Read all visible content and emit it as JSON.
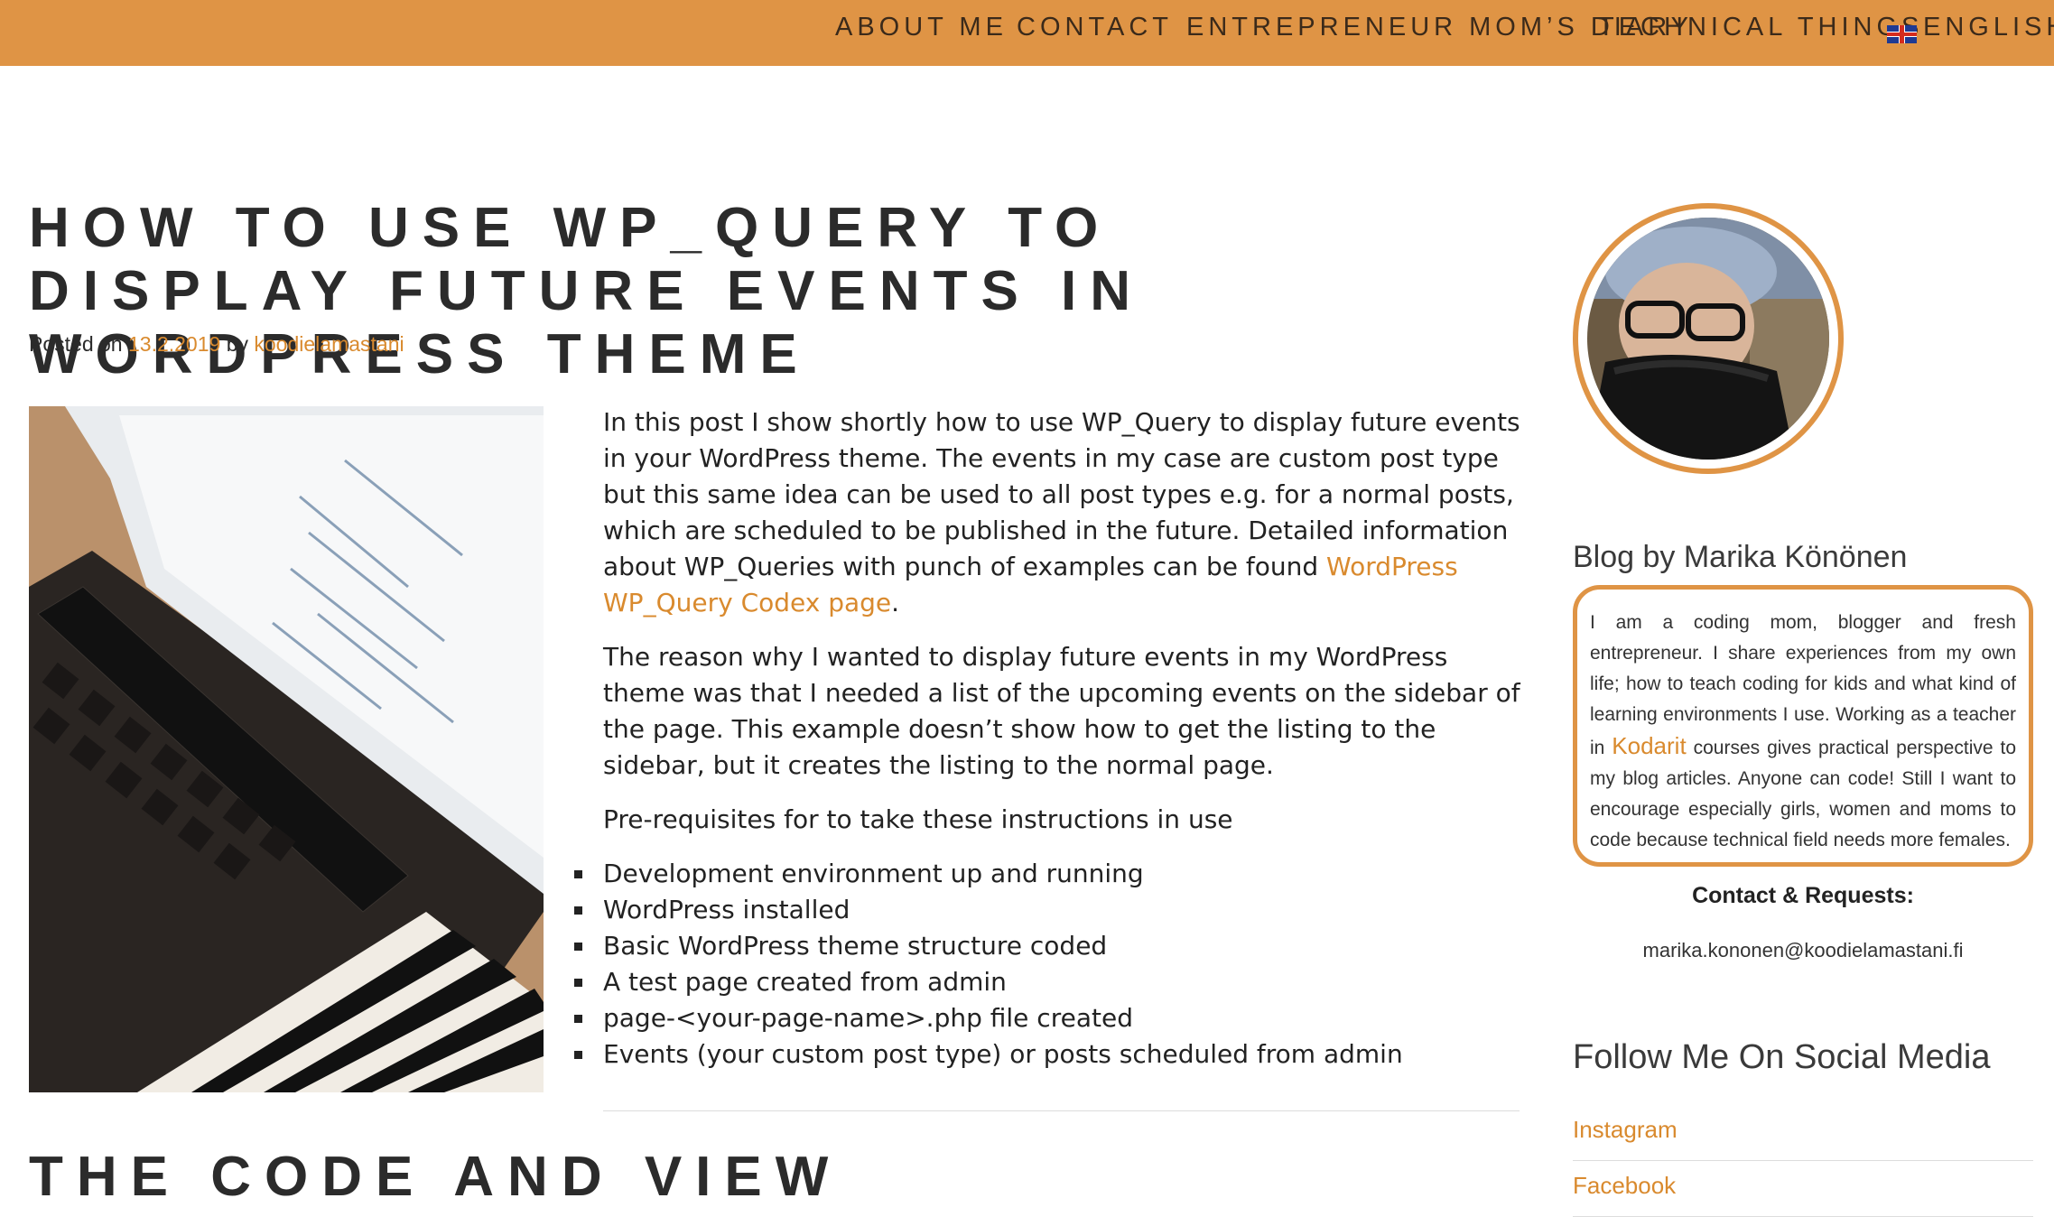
{
  "nav": {
    "items": [
      "ABOUT ME",
      "CONTACT",
      "ENTREPRENEUR MOM’S DIARY",
      "TECHNICAL THINGS"
    ],
    "language": "ENGLISH"
  },
  "post": {
    "title": "HOW TO USE WP_QUERY TO DISPLAY FUTURE EVENTS IN WORDPRESS THEME",
    "meta_prefix": "Posted on",
    "date": "13.2.2019",
    "by": "by",
    "author": "koodielamastani",
    "paragraph1_text": "In this post I show shortly how to use WP_Query to display future events in your WordPress theme. The events in my case are custom post type but this same idea can be used to all post types e.g. for a normal posts, which are scheduled to be published in the future. Detailed information about WP_Queries with punch of examples can be found ",
    "paragraph1_link": "WordPress WP_Query Codex page",
    "paragraph1_end": ".",
    "paragraph2": "The reason why I wanted to display future events in my WordPress theme was that I needed a list of the upcoming events on the sidebar of the page. This example doesn’t show how to get the listing to the sidebar, but it creates the listing to the normal page.",
    "paragraph3": "Pre-requisites for to take these instructions in use",
    "prerequisites": [
      "Development environment up and running",
      "WordPress installed",
      "Basic WordPress theme structure coded",
      "A test page created from admin",
      "page-<your-page-name>.php file created",
      "Events (your custom post type) or posts scheduled from admin"
    ],
    "section_title": "THE CODE AND VIEW"
  },
  "sidebar": {
    "blog_by": "Blog by Marika Könönen",
    "bio_before": "I am a coding mom, blogger and fresh entrepreneur. I share experiences from my own life; how to teach coding for kids and what kind of learning environments I use. Working as a teacher in ",
    "bio_link": "Kodarit",
    "bio_after": " courses gives practical perspective to my blog articles. Anyone can code! Still I want to encourage especially girls, women and moms to code because technical field needs more females.",
    "contact_heading": "Contact & Requests:",
    "contact_email": "marika.kononen@koodielamastani.fi",
    "social_heading": "Follow Me On Social Media",
    "social_links": [
      "Instagram",
      "Facebook"
    ]
  },
  "colors": {
    "accent": "#df9445",
    "link": "#d98a2e",
    "text": "#222222"
  },
  "icons": {
    "language_flag": "uk-flag-icon"
  }
}
